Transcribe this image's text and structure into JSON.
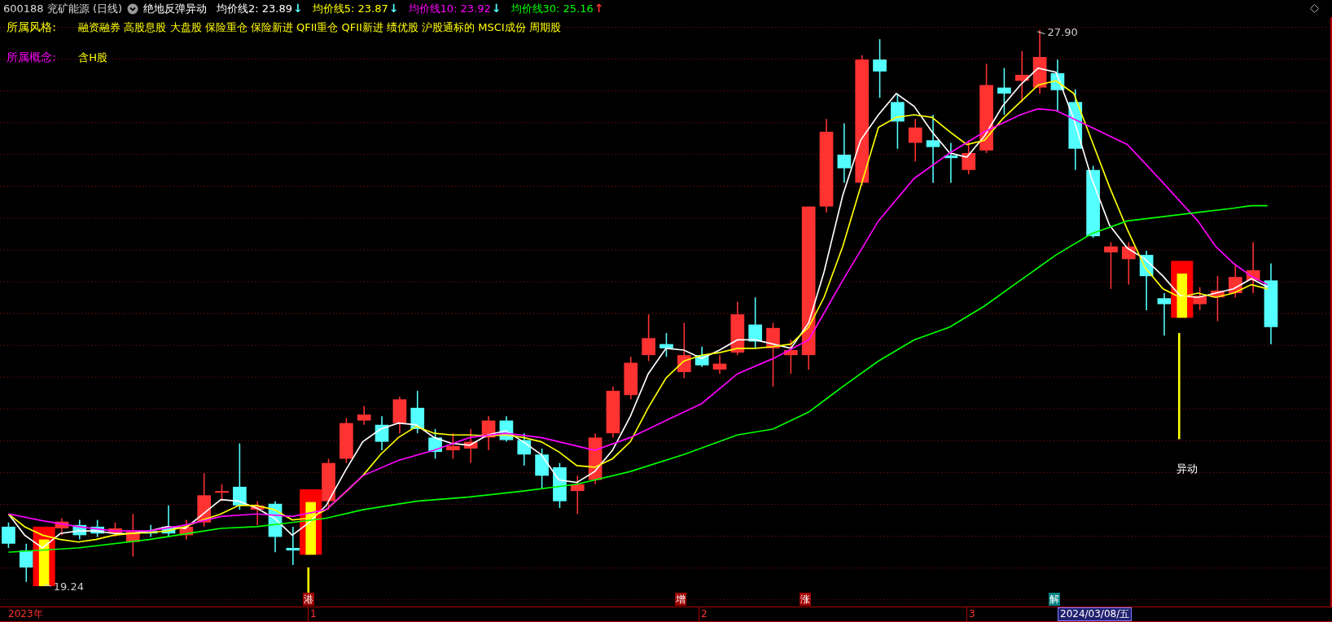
{
  "header": {
    "stock": "600188 兖矿能源 (日线)",
    "indicator": "绝地反弹异动",
    "averages": [
      {
        "label": "均价线2: 23.89",
        "arrow": {
          "text": "↓",
          "color": "#54ffff"
        },
        "color": "#ffffff"
      },
      {
        "label": "均价线5: 23.87",
        "arrow": {
          "text": "↓",
          "color": "#54ffff"
        },
        "color": "#ffff00"
      },
      {
        "label": "均价线10: 23.92",
        "arrow": {
          "text": "↓",
          "color": "#54ffff"
        },
        "color": "#ff00ff"
      },
      {
        "label": "均价线30: 25.16",
        "arrow": {
          "text": "↑",
          "color": "#ff3232"
        },
        "color": "#00ff00"
      }
    ]
  },
  "info_rows": [
    {
      "label": "所属风格:",
      "color": "#ffff00",
      "value": "融资融券 高股息股 大盘股 保险重仓 保险新进 QFII重仓 QFII新进 绩优股 沪股通标的 MSCI成份 周期股"
    },
    {
      "label": "所属概念:",
      "color": "#ff00ff",
      "value": "含H股"
    }
  ],
  "chart": {
    "high_label": "27.90",
    "low_label": "19.24",
    "signal_label": "异动",
    "markers": [
      {
        "text": "港",
        "color": "#a00000"
      },
      {
        "text": "增",
        "color": "#a00000"
      },
      {
        "text": "涨",
        "color": "#a00000"
      },
      {
        "text": "解",
        "color": "#008080"
      }
    ]
  },
  "time_axis": {
    "year": "2023年",
    "months": [
      "1",
      "2",
      "3"
    ],
    "cursor_date": "2024/03/08/五"
  }
}
